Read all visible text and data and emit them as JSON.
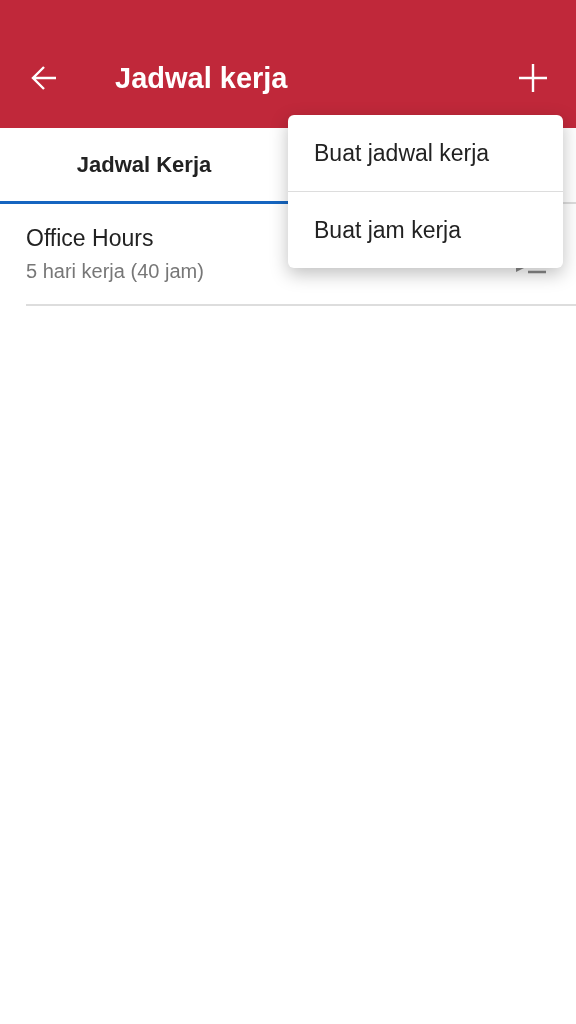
{
  "app_bar": {
    "title": "Jadwal kerja"
  },
  "tabs": [
    {
      "label": "Jadwal Kerja",
      "selected": true
    }
  ],
  "schedules": [
    {
      "name": "Office Hours",
      "detail": "5 hari kerja (40 jam)"
    }
  ],
  "menu": {
    "items": [
      {
        "label": "Buat jadwal kerja"
      },
      {
        "label": "Buat jam kerja"
      }
    ]
  }
}
